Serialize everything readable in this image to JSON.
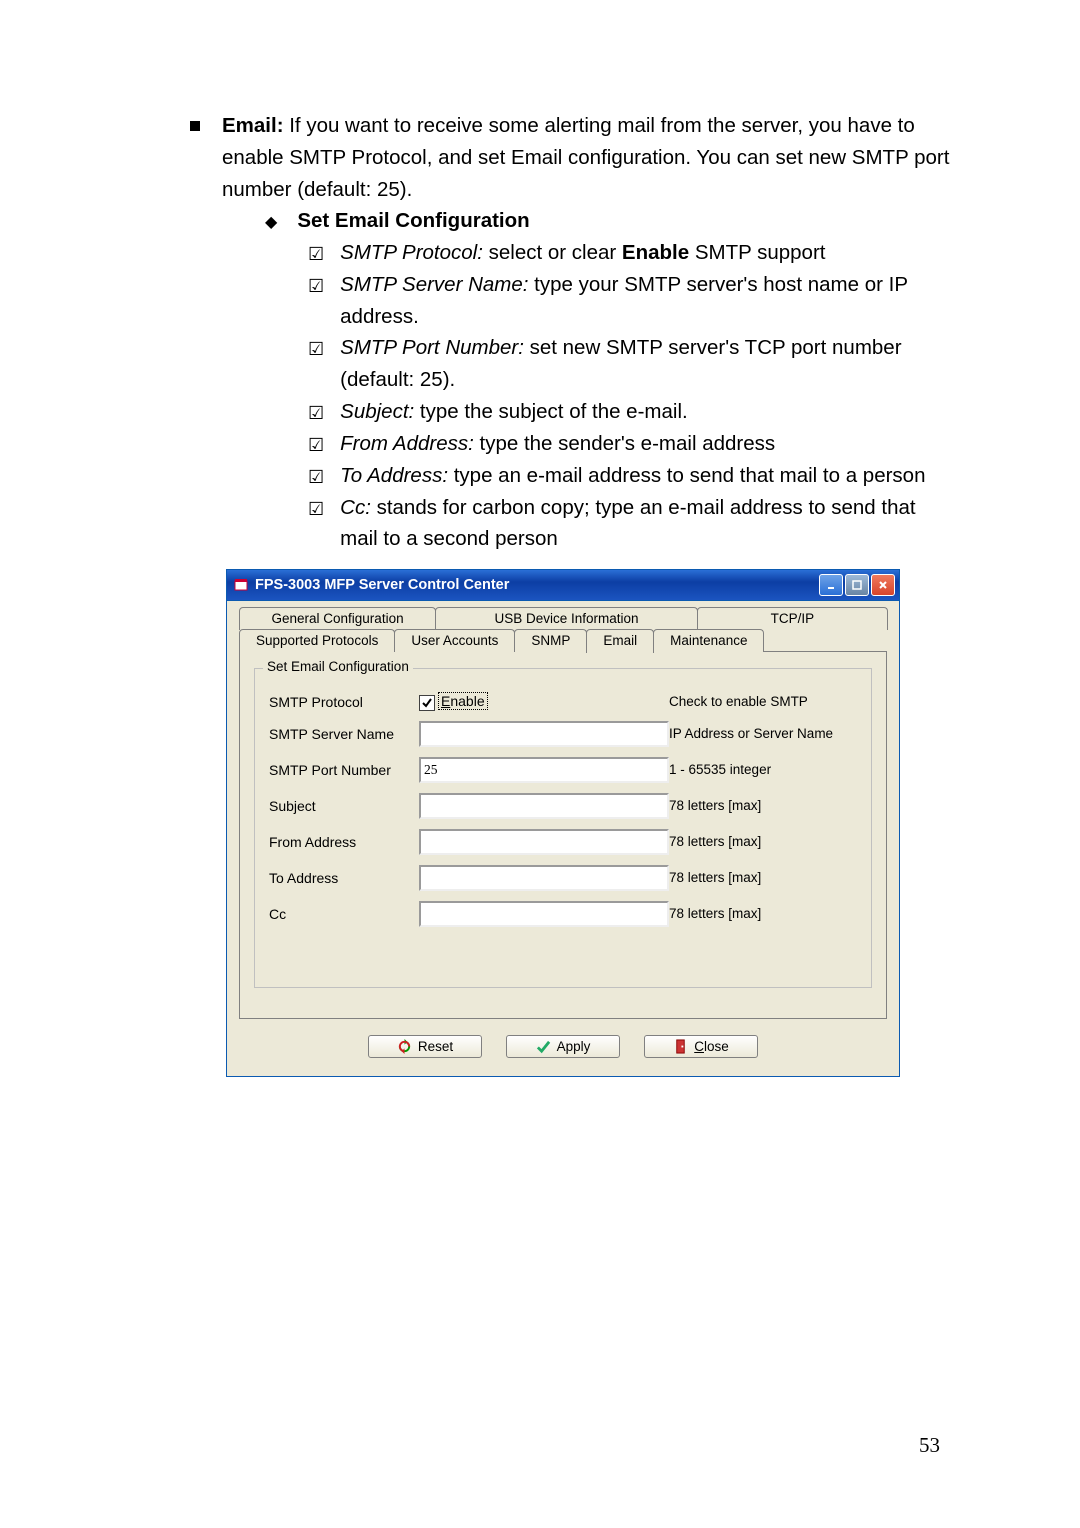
{
  "doc": {
    "email_head": "Email:",
    "email_text": " If you want to receive some alerting mail from the server, you have to enable SMTP Protocol, and set Email configuration. You can set new SMTP port number (default: 25).",
    "sub_head": "Set Email Configuration",
    "items": [
      {
        "term": "SMTP Protocol:",
        "text": " select or clear ",
        "bold": "Enable",
        "tail": " SMTP support"
      },
      {
        "term": "SMTP Server Name:",
        "text": " type your SMTP server's host name or IP address."
      },
      {
        "term": "SMTP Port Number:",
        "text": " set new SMTP server's TCP port number (default: 25)."
      },
      {
        "term": "Subject:",
        "text": " type the subject of the e-mail."
      },
      {
        "term": "From Address:",
        "text": " type the sender's e-mail address"
      },
      {
        "term": "To Address:",
        "text": " type an e-mail address to send that mail to a person"
      },
      {
        "term": "Cc:",
        "text": " stands for carbon copy; type an e-mail address to send that mail to a second person"
      }
    ],
    "page_number": "53"
  },
  "window": {
    "title": "FPS-3003 MFP Server Control Center",
    "tabs_top": [
      "General Configuration",
      "USB Device Information",
      "TCP/IP"
    ],
    "tabs_bottom": [
      "Supported Protocols",
      "User Accounts",
      "SNMP",
      "Email",
      "Maintenance"
    ],
    "active_tab": "Email",
    "group_title": "Set Email Configuration",
    "fields": {
      "smtp_protocol": {
        "label": "SMTP Protocol",
        "checkbox": "Enable",
        "hint": "Check to enable SMTP"
      },
      "smtp_server": {
        "label": "SMTP Server Name",
        "value": "",
        "hint": "IP Address or Server Name"
      },
      "smtp_port": {
        "label": "SMTP Port Number",
        "value": "25",
        "hint": "1 - 65535 integer"
      },
      "subject": {
        "label": "Subject",
        "value": "",
        "hint": "78 letters [max]"
      },
      "from": {
        "label": "From Address",
        "value": "",
        "hint": "78 letters [max]"
      },
      "to": {
        "label": "To Address",
        "value": "",
        "hint": "78 letters [max]"
      },
      "cc": {
        "label": "Cc",
        "value": "",
        "hint": "78 letters [max]"
      }
    },
    "buttons": {
      "reset": "Reset",
      "apply": "Apply",
      "close": "Close"
    }
  }
}
